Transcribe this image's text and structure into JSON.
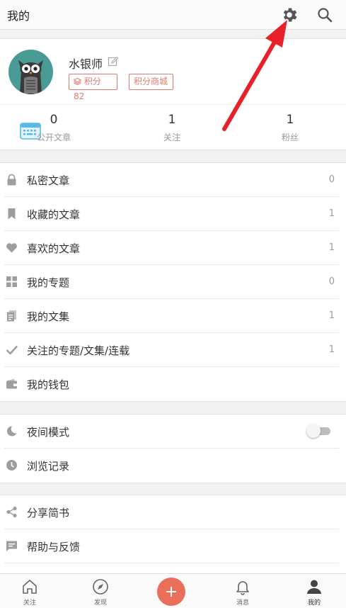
{
  "header": {
    "title": "我的",
    "settings_icon": "gear-icon",
    "search_icon": "search-icon"
  },
  "profile": {
    "username": "水银师",
    "points_tag": "积分 82",
    "mall_tag": "积分商城",
    "stats": [
      {
        "value": "0",
        "label": "公开文章"
      },
      {
        "value": "1",
        "label": "关注"
      },
      {
        "value": "1",
        "label": "粉丝"
      }
    ]
  },
  "menu_group_1": [
    {
      "label": "私密文章",
      "count": "0",
      "icon": "lock-icon"
    },
    {
      "label": "收藏的文章",
      "count": "1",
      "icon": "bookmark-icon"
    },
    {
      "label": "喜欢的文章",
      "count": "1",
      "icon": "heart-icon"
    },
    {
      "label": "我的专题",
      "count": "0",
      "icon": "grid-icon"
    },
    {
      "label": "我的文集",
      "count": "1",
      "icon": "notebook-icon"
    },
    {
      "label": "关注的专题/文集/连载",
      "count": "1",
      "icon": "check-icon"
    },
    {
      "label": "我的钱包",
      "count": "",
      "icon": "wallet-icon"
    }
  ],
  "menu_group_2": [
    {
      "label": "夜间模式",
      "icon": "moon-icon",
      "toggle": "off"
    },
    {
      "label": "浏览记录",
      "icon": "clock-icon"
    }
  ],
  "menu_group_3": [
    {
      "label": "分享简书",
      "icon": "share-icon"
    },
    {
      "label": "帮助与反馈",
      "icon": "feedback-icon"
    }
  ],
  "tabbar": [
    {
      "label": "关注",
      "icon": "home-icon"
    },
    {
      "label": "发现",
      "icon": "compass-icon"
    },
    {
      "label": "",
      "icon": "plus-icon"
    },
    {
      "label": "消息",
      "icon": "bell-icon"
    },
    {
      "label": "我的",
      "icon": "user-icon"
    }
  ],
  "colors": {
    "accent": "#ea6f5a",
    "tag": "#e07a6e",
    "arrow": "#e8202a",
    "avatar_bg": "#4a9a96"
  }
}
